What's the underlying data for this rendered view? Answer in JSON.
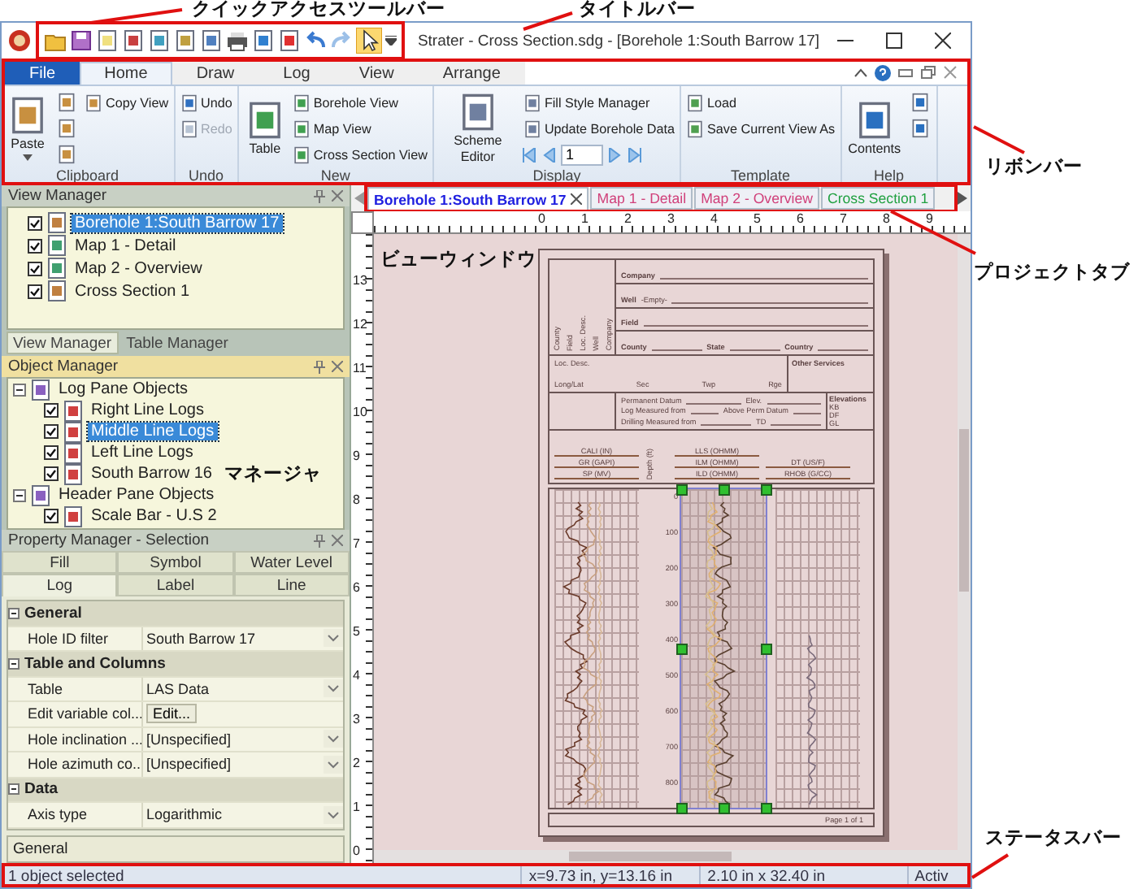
{
  "callouts": {
    "quick_access": "クイックアクセスツールバー",
    "title_bar": "タイトルバー",
    "ribbon": "リボンバー",
    "project_tabs": "プロジェクトタブ",
    "view_window": "ビューウィンドウ",
    "manager": "マネージャ",
    "status_bar": "ステータスバー"
  },
  "window": {
    "title": "Strater - Cross Section.sdg - [Borehole 1:South Barrow 17]"
  },
  "ribbon": {
    "tabs": [
      {
        "label": "File",
        "kind": "file",
        "selected": false
      },
      {
        "label": "Home",
        "kind": "tab",
        "selected": true
      },
      {
        "label": "Draw",
        "kind": "tab",
        "selected": false
      },
      {
        "label": "Log",
        "kind": "tab",
        "selected": false
      },
      {
        "label": "View",
        "kind": "tab",
        "selected": false
      },
      {
        "label": "Arrange",
        "kind": "tab",
        "selected": false
      }
    ],
    "groups": [
      {
        "name": "Clipboard",
        "items": [
          {
            "kind": "large",
            "label": "Paste",
            "menu": true,
            "disabled": false
          },
          {
            "kind": "icon"
          },
          {
            "kind": "icon"
          },
          {
            "kind": "icon"
          },
          {
            "kind": "small",
            "label": "Copy View",
            "disabled": false
          }
        ]
      },
      {
        "name": "Undo",
        "items": [
          {
            "kind": "small",
            "label": "Undo",
            "disabled": false
          },
          {
            "kind": "small",
            "label": "Redo",
            "disabled": true
          }
        ]
      },
      {
        "name": "New",
        "items": [
          {
            "kind": "large",
            "label": "Table",
            "menu": false,
            "disabled": false
          },
          {
            "kind": "small",
            "label": "Borehole View",
            "disabled": false
          },
          {
            "kind": "small",
            "label": "Map View",
            "disabled": false
          },
          {
            "kind": "small",
            "label": "Cross Section View",
            "disabled": false
          }
        ]
      },
      {
        "name": "Display",
        "items": [
          {
            "kind": "large",
            "label": "Scheme Editor",
            "menu": false,
            "disabled": false
          },
          {
            "kind": "small",
            "label": "Fill Style Manager",
            "disabled": false
          },
          {
            "kind": "small",
            "label": "Update Borehole Data",
            "disabled": false
          },
          {
            "kind": "pager",
            "value": "1"
          }
        ]
      },
      {
        "name": "Template",
        "items": [
          {
            "kind": "small",
            "label": "Load",
            "disabled": false
          },
          {
            "kind": "small",
            "label": "Save Current View As",
            "disabled": false
          }
        ]
      },
      {
        "name": "Help",
        "items": [
          {
            "kind": "large",
            "label": "Contents",
            "menu": false,
            "disabled": false
          },
          {
            "kind": "icon"
          },
          {
            "kind": "icon"
          }
        ]
      }
    ]
  },
  "view_manager": {
    "title": "View Manager",
    "items": [
      {
        "label": "Borehole 1:South Barrow 17",
        "checked": true,
        "selected": true
      },
      {
        "label": "Map 1 - Detail",
        "checked": true,
        "selected": false
      },
      {
        "label": "Map 2 - Overview",
        "checked": true,
        "selected": false
      },
      {
        "label": "Cross Section 1",
        "checked": true,
        "selected": false
      }
    ],
    "tabs": [
      {
        "label": "View Manager",
        "selected": true
      },
      {
        "label": "Table Manager",
        "selected": false
      }
    ]
  },
  "object_manager": {
    "title": "Object Manager",
    "items": [
      {
        "label": "Log Pane Objects",
        "expanded": true,
        "children": [
          {
            "label": "Right Line Logs",
            "checked": true,
            "selected": false
          },
          {
            "label": "Middle Line Logs",
            "checked": true,
            "selected": true
          },
          {
            "label": "Left Line Logs",
            "checked": true,
            "selected": false
          },
          {
            "label": "South Barrow 16",
            "checked": true,
            "selected": false
          }
        ]
      },
      {
        "label": "Header Pane Objects",
        "expanded": true,
        "children": [
          {
            "label": "Scale Bar - U.S 2",
            "checked": true,
            "selected": false
          }
        ]
      }
    ]
  },
  "property_manager": {
    "title": "Property Manager - Selection",
    "tab_rows": [
      [
        {
          "label": "Fill",
          "selected": false
        },
        {
          "label": "Symbol",
          "selected": false
        },
        {
          "label": "Water Level",
          "selected": false
        }
      ],
      [
        {
          "label": "Log",
          "selected": true
        },
        {
          "label": "Label",
          "selected": false
        },
        {
          "label": "Line",
          "selected": false
        }
      ]
    ],
    "rows": [
      {
        "kind": "section",
        "label": "General"
      },
      {
        "kind": "dropdown",
        "label": "Hole ID filter",
        "value": "South Barrow 17"
      },
      {
        "kind": "section",
        "label": "Table and Columns"
      },
      {
        "kind": "dropdown",
        "label": "Table",
        "value": "LAS Data"
      },
      {
        "kind": "button",
        "label": "Edit variable col...",
        "value": "Edit..."
      },
      {
        "kind": "dropdown",
        "label": "Hole inclination ...",
        "value": "[Unspecified]"
      },
      {
        "kind": "dropdown",
        "label": "Hole azimuth co...",
        "value": "[Unspecified]"
      },
      {
        "kind": "section",
        "label": "Data"
      },
      {
        "kind": "dropdown",
        "label": "Axis type",
        "value": "Logarithmic"
      }
    ],
    "description": "General"
  },
  "document_tabs": [
    {
      "label": "Borehole 1:South Barrow 17",
      "color": "#2020e0",
      "selected": true
    },
    {
      "label": "Map 1 - Detail",
      "color": "#d0407a",
      "selected": false
    },
    {
      "label": "Map 2 - Overview",
      "color": "#d0407a",
      "selected": false
    },
    {
      "label": "Cross Section 1",
      "color": "#20a040",
      "selected": false
    }
  ],
  "rulers": {
    "horizontal": [
      "0",
      "1",
      "2",
      "3",
      "4",
      "5",
      "6",
      "7",
      "8",
      "9"
    ],
    "vertical": [
      "13",
      "12",
      "11",
      "10",
      "9",
      "8",
      "7",
      "6",
      "5",
      "4",
      "3",
      "2",
      "1",
      "0"
    ]
  },
  "log_page": {
    "side_labels": [
      "County",
      "Field",
      "Loc. Desc.",
      "Well",
      "Company"
    ],
    "company": "Company",
    "well": "Well",
    "well_value": "-Empty-",
    "field": "Field",
    "location": [
      "County",
      "State",
      "Country"
    ],
    "loc_desc": "Loc. Desc.",
    "other_services": "Other Services",
    "legal": [
      "Long/Lat",
      "Sec",
      "Twp",
      "Rge"
    ],
    "datum": [
      [
        "Permanent Datum",
        "Elev."
      ],
      [
        "Log Measured from",
        "Above Perm Datum"
      ],
      [
        "Drilling Measured from",
        "TD"
      ]
    ],
    "elevations_title": "Elevations",
    "elevations": [
      "KB",
      "DF",
      "GL"
    ],
    "tracks": [
      {
        "curves": [
          "CALI (IN)",
          "GR (GAPI)",
          "SP (MV)"
        ],
        "selected": false
      },
      {
        "curves": [
          "LLS (OHMM)",
          "ILM (OHMM)",
          "ILD (OHMM)"
        ],
        "selected": true
      },
      {
        "curves": [
          "DT (US/F)",
          "RHOB (G/CC)"
        ],
        "selected": false
      }
    ],
    "depth_label": "Depth (ft)",
    "depths": [
      "0",
      "100",
      "200",
      "300",
      "400",
      "500",
      "600",
      "700",
      "800"
    ],
    "footer": "Page 1 of 1"
  },
  "status_bar": [
    "1 object selected",
    "x=9.73 in, y=13.16 in",
    "2.10 in x 32.40 in",
    "Activ"
  ]
}
